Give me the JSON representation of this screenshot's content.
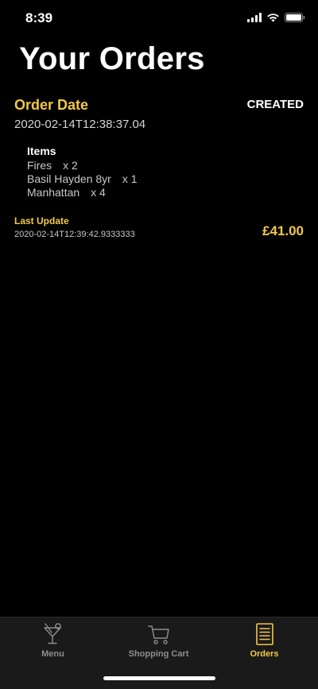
{
  "status_bar": {
    "time": "8:39",
    "icons": [
      "cellular-signal-icon",
      "wifi-icon",
      "battery-icon"
    ]
  },
  "page": {
    "title": "Your Orders"
  },
  "order": {
    "date_label": "Order Date",
    "status": "CREATED",
    "date_value": "2020-02-14T12:38:37.04",
    "items_heading": "Items",
    "items": [
      {
        "name": "Fires",
        "qty": "x 2"
      },
      {
        "name": "Basil Hayden 8yr",
        "qty": "x 1"
      },
      {
        "name": "Manhattan",
        "qty": "x 4"
      }
    ],
    "last_update_label": "Last Update",
    "last_update_value": "2020-02-14T12:39:42.9333333",
    "total": "£41.00"
  },
  "tab_bar": {
    "tabs": [
      {
        "label": "Menu",
        "icon": "cocktail-glass-icon",
        "active": false
      },
      {
        "label": "Shopping Cart",
        "icon": "shopping-cart-icon",
        "active": false
      },
      {
        "label": "Orders",
        "icon": "receipt-list-icon",
        "active": true
      }
    ]
  },
  "colors": {
    "accent": "#f2c84b",
    "background": "#000000",
    "tab_bar_background": "#1a1a1a",
    "inactive": "#8e8e8e"
  }
}
